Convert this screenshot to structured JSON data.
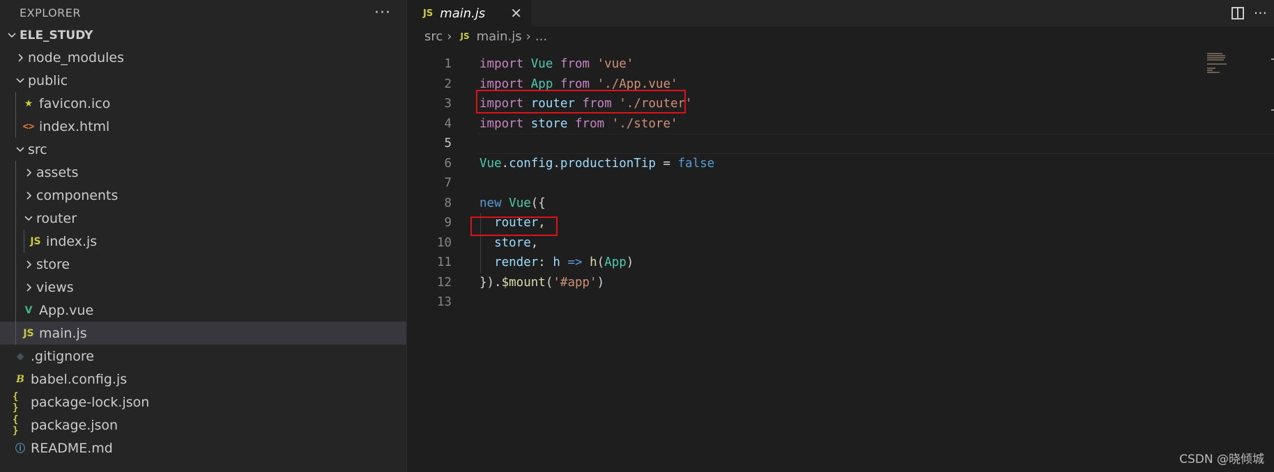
{
  "explorer": {
    "title": "EXPLORER",
    "more": "···",
    "workspace": "ELE_STUDY",
    "items": [
      {
        "label": "node_modules",
        "type": "folder",
        "expanded": false,
        "depth": 1
      },
      {
        "label": "public",
        "type": "folder",
        "expanded": true,
        "depth": 1
      },
      {
        "label": "favicon.ico",
        "type": "favicon",
        "depth": 2
      },
      {
        "label": "index.html",
        "type": "html",
        "depth": 2
      },
      {
        "label": "src",
        "type": "folder",
        "expanded": true,
        "depth": 1
      },
      {
        "label": "assets",
        "type": "folder",
        "expanded": false,
        "depth": 2
      },
      {
        "label": "components",
        "type": "folder",
        "expanded": false,
        "depth": 2
      },
      {
        "label": "router",
        "type": "folder",
        "expanded": true,
        "depth": 2
      },
      {
        "label": "index.js",
        "type": "js",
        "depth": 3
      },
      {
        "label": "store",
        "type": "folder",
        "expanded": false,
        "depth": 2
      },
      {
        "label": "views",
        "type": "folder",
        "expanded": false,
        "depth": 2
      },
      {
        "label": "App.vue",
        "type": "vue",
        "depth": 2
      },
      {
        "label": "main.js",
        "type": "js",
        "depth": 2,
        "selected": true
      },
      {
        "label": ".gitignore",
        "type": "git",
        "depth": 1
      },
      {
        "label": "babel.config.js",
        "type": "babel",
        "depth": 1
      },
      {
        "label": "package-lock.json",
        "type": "json",
        "depth": 1
      },
      {
        "label": "package.json",
        "type": "json",
        "depth": 1
      },
      {
        "label": "README.md",
        "type": "info",
        "depth": 1
      }
    ]
  },
  "icons": {
    "js": "JS",
    "json": "{ }",
    "html": "<>",
    "favicon": "★",
    "vue": "V",
    "git": "◆",
    "babel": "B",
    "info": "ⓘ",
    "chevron_right": "›",
    "chevron_down": "⌄"
  },
  "editor": {
    "tab_label": "main.js",
    "tab_close": "✕",
    "actions_more": "···",
    "breadcrumb": [
      "src",
      "main.js",
      "..."
    ],
    "current_line": 5,
    "lines": [
      [
        [
          "kw",
          "import"
        ],
        [
          "pn",
          " "
        ],
        [
          "cls",
          "Vue"
        ],
        [
          "pn",
          " "
        ],
        [
          "kw",
          "from"
        ],
        [
          "pn",
          " "
        ],
        [
          "str",
          "'vue'"
        ]
      ],
      [
        [
          "kw",
          "import"
        ],
        [
          "pn",
          " "
        ],
        [
          "cls",
          "App"
        ],
        [
          "pn",
          " "
        ],
        [
          "kw",
          "from"
        ],
        [
          "pn",
          " "
        ],
        [
          "str",
          "'./App.vue'"
        ]
      ],
      [
        [
          "kw",
          "import"
        ],
        [
          "pn",
          " "
        ],
        [
          "id",
          "router"
        ],
        [
          "pn",
          " "
        ],
        [
          "kw",
          "from"
        ],
        [
          "pn",
          " "
        ],
        [
          "str",
          "'./router'"
        ]
      ],
      [
        [
          "kw",
          "import"
        ],
        [
          "pn",
          " "
        ],
        [
          "id",
          "store"
        ],
        [
          "pn",
          " "
        ],
        [
          "kw",
          "from"
        ],
        [
          "pn",
          " "
        ],
        [
          "str",
          "'./store'"
        ]
      ],
      [],
      [
        [
          "cls",
          "Vue"
        ],
        [
          "pn",
          "."
        ],
        [
          "id",
          "config"
        ],
        [
          "pn",
          "."
        ],
        [
          "id",
          "productionTip"
        ],
        [
          "pn",
          " = "
        ],
        [
          "bool",
          "false"
        ]
      ],
      [],
      [
        [
          "bool",
          "new"
        ],
        [
          "pn",
          " "
        ],
        [
          "cls",
          "Vue"
        ],
        [
          "pn",
          "({"
        ]
      ],
      [
        [
          "pn",
          "  "
        ],
        [
          "id",
          "router"
        ],
        [
          "pn",
          ","
        ]
      ],
      [
        [
          "pn",
          "  "
        ],
        [
          "id",
          "store"
        ],
        [
          "pn",
          ","
        ]
      ],
      [
        [
          "pn",
          "  "
        ],
        [
          "id",
          "render"
        ],
        [
          "pn",
          ": "
        ],
        [
          "id",
          "h"
        ],
        [
          "pn",
          " "
        ],
        [
          "bool",
          "=>"
        ],
        [
          "pn",
          " "
        ],
        [
          "fn",
          "h"
        ],
        [
          "pn",
          "("
        ],
        [
          "cls",
          "App"
        ],
        [
          "pn",
          ")"
        ]
      ],
      [
        [
          "pn",
          "})."
        ],
        [
          "fn",
          "$mount"
        ],
        [
          "pn",
          "("
        ],
        [
          "str",
          "'#app'"
        ],
        [
          "pn",
          ")"
        ]
      ],
      []
    ]
  },
  "watermark": "CSDN @晓倾城"
}
